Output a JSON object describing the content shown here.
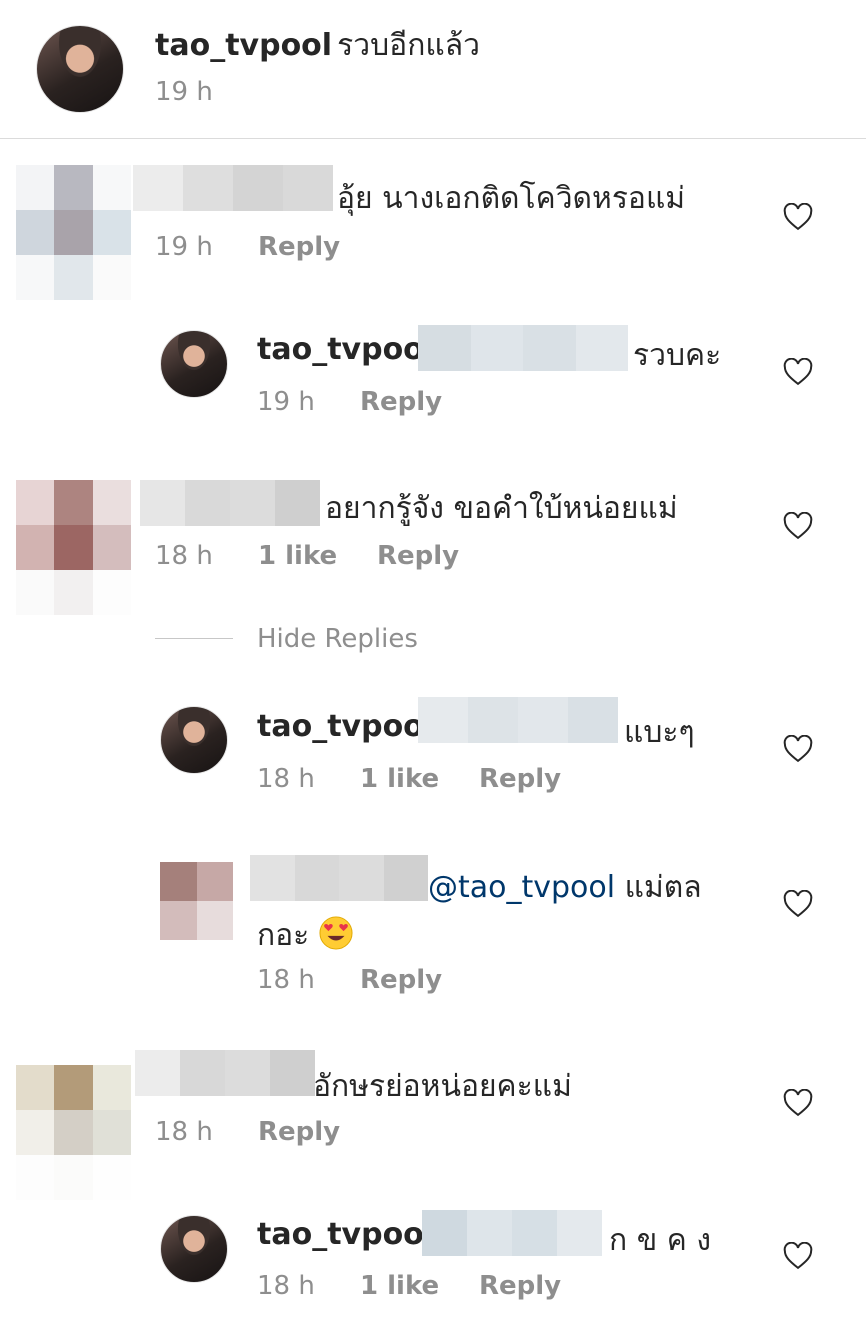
{
  "caption": {
    "username": "tao_tvpool",
    "text": "รวบอีกแล้ว",
    "time": "19 h"
  },
  "comments": [
    {
      "text": "อุ้ย นางเอกติดโควิดหรอแม่",
      "time": "19 h",
      "reply_label": "Reply"
    },
    {
      "username": "tao_tvpool",
      "text": "รวบคะ",
      "time": "19 h",
      "reply_label": "Reply"
    },
    {
      "text": "อยากรู้จัง ขอคำใบ้หน่อยแม่",
      "time": "18 h",
      "likes": "1 like",
      "reply_label": "Reply"
    },
    {
      "hide_replies": "Hide Replies"
    },
    {
      "username": "tao_tvpool",
      "text": "แบะๆ",
      "time": "18 h",
      "likes": "1 like",
      "reply_label": "Reply"
    },
    {
      "mention": "@tao_tvpool",
      "text_line1": "แม่ตล",
      "text_line2": "กอะ",
      "emoji": "heart-eyes-emoji",
      "time": "18 h",
      "reply_label": "Reply"
    },
    {
      "text": "อักษรย่อหน่อยคะแม่",
      "time": "18 h",
      "reply_label": "Reply"
    },
    {
      "username": "tao_tvpool",
      "text": "ก ข ค ง",
      "time": "18 h",
      "likes": "1 like",
      "reply_label": "Reply"
    }
  ],
  "colors": {
    "text": "#262626",
    "meta": "#8e8e8e",
    "mention": "#00376b",
    "divider": "#dbdbdb"
  },
  "icons": {
    "like": "heart-outline-icon"
  }
}
